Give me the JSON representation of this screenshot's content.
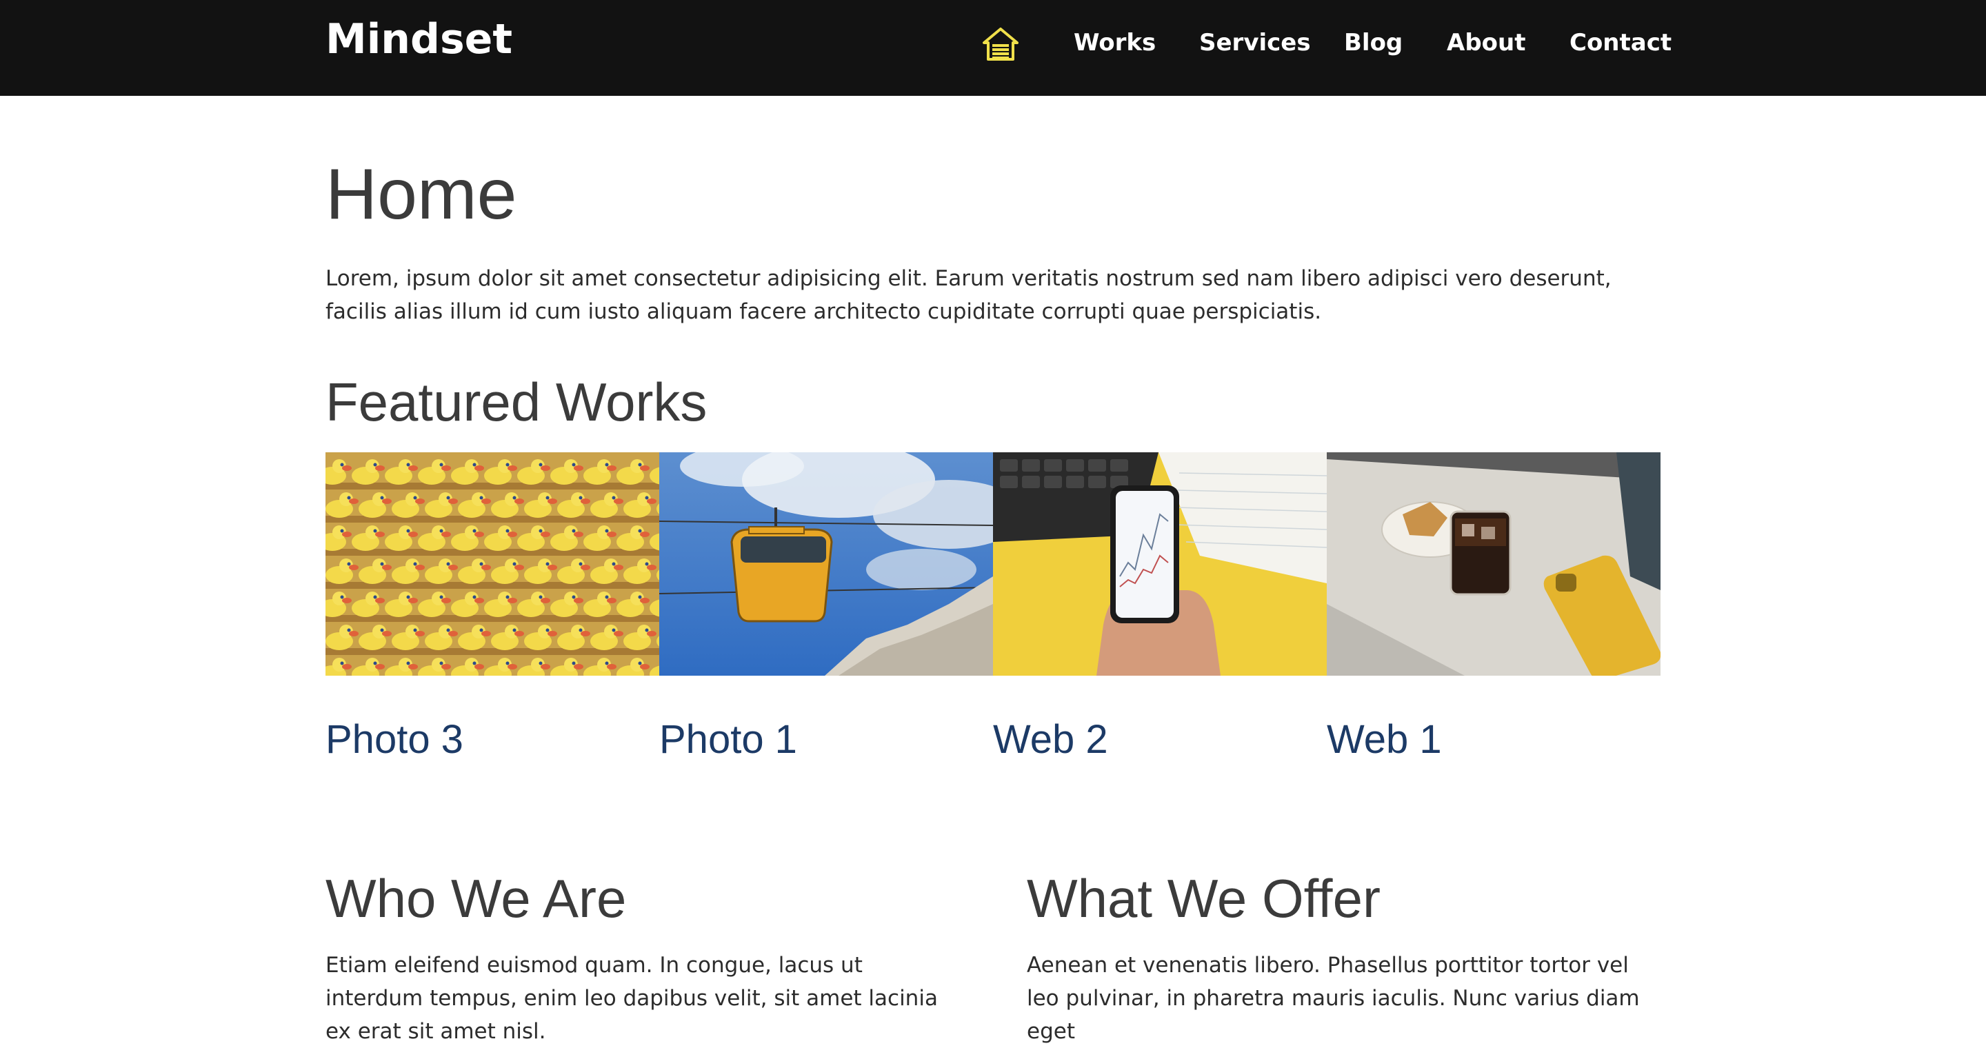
{
  "header": {
    "brand": "Mindset",
    "home_icon": "home-icon",
    "nav": [
      "Works",
      "Services",
      "Blog",
      "About",
      "Contact"
    ],
    "accent_color": "#f0e04a",
    "background": "#121212"
  },
  "main": {
    "title": "Home",
    "intro": "Lorem, ipsum dolor sit amet consectetur adipisicing elit. Earum veritatis nostrum sed nam libero adipisci vero deserunt, facilis alias illum id cum iusto aliquam facere architecto cupiditate corrupti quae perspiciatis.",
    "featured_heading": "Featured Works",
    "works": [
      {
        "title": "Photo 3",
        "image": "rubber-ducks-photo"
      },
      {
        "title": "Photo 1",
        "image": "cable-car-photo"
      },
      {
        "title": "Web 2",
        "image": "phone-chart-photo"
      },
      {
        "title": "Web 1",
        "image": "coffee-phone-photo"
      }
    ],
    "who_heading": "Who We Are",
    "who_text": "Etiam eleifend euismod quam. In congue, lacus ut interdum tempus, enim leo dapibus velit, sit amet lacinia ex erat sit amet nisl.",
    "offer_heading": "What We Offer",
    "offer_text": "Aenean et venenatis libero. Phasellus porttitor tortor vel leo pulvinar, in pharetra mauris iaculis. Nunc varius diam eget"
  }
}
